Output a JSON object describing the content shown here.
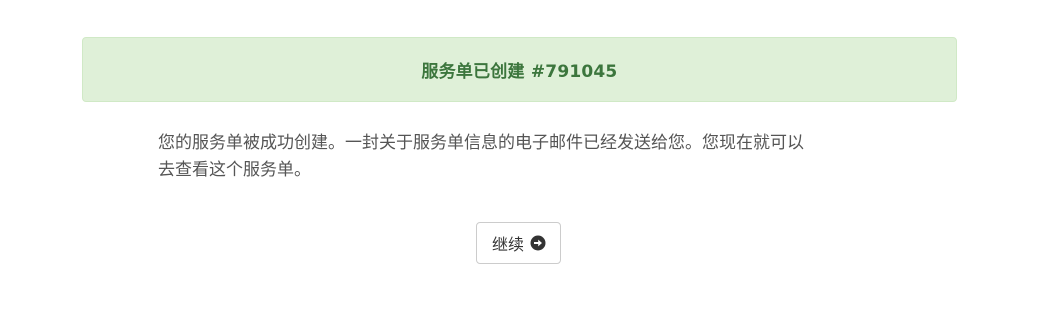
{
  "alert": {
    "title": "服务单已创建 #791045"
  },
  "message": {
    "line1": "您的服务单被成功创建。一封关于服务单信息的电子邮件已经发送给您。您现在就可以",
    "line2": "去查看这个服务单。"
  },
  "continue_button": {
    "label": "继续",
    "icon": "arrow-circle-right-icon"
  },
  "colors": {
    "alert_bg": "#dff0d8",
    "alert_text": "#3c763d",
    "body_text": "#555555",
    "button_border": "#cccccc"
  }
}
